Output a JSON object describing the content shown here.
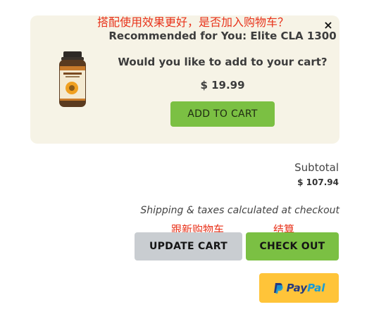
{
  "annotations": {
    "top": "搭配使用效果更好，是否加入购物车？",
    "update": "跟新购物车",
    "checkout": "结算"
  },
  "recommendation": {
    "title": "Recommended for You: Elite CLA 1300",
    "question": "Would you like to add to your cart?",
    "price": "$ 19.99",
    "add_button": "ADD TO CART",
    "close": "×"
  },
  "cart": {
    "subtotal_label": "Subtotal",
    "subtotal_value": "$ 107.94",
    "shipping_note": "Shipping & taxes calculated at checkout",
    "update_button": "UPDATE CART",
    "checkout_button": "CHECK OUT",
    "paypal_pay": "Pay",
    "paypal_pal": "Pal"
  },
  "colors": {
    "panel_bg": "#f6f3e6",
    "green": "#7bc043",
    "gray_button": "#c9cdd1",
    "paypal_yellow": "#ffc439",
    "annotation_red": "#e8331b"
  },
  "icons": {
    "close": "close-icon",
    "paypal": "paypal-logo-icon",
    "product": "supplement-bottle-icon"
  }
}
